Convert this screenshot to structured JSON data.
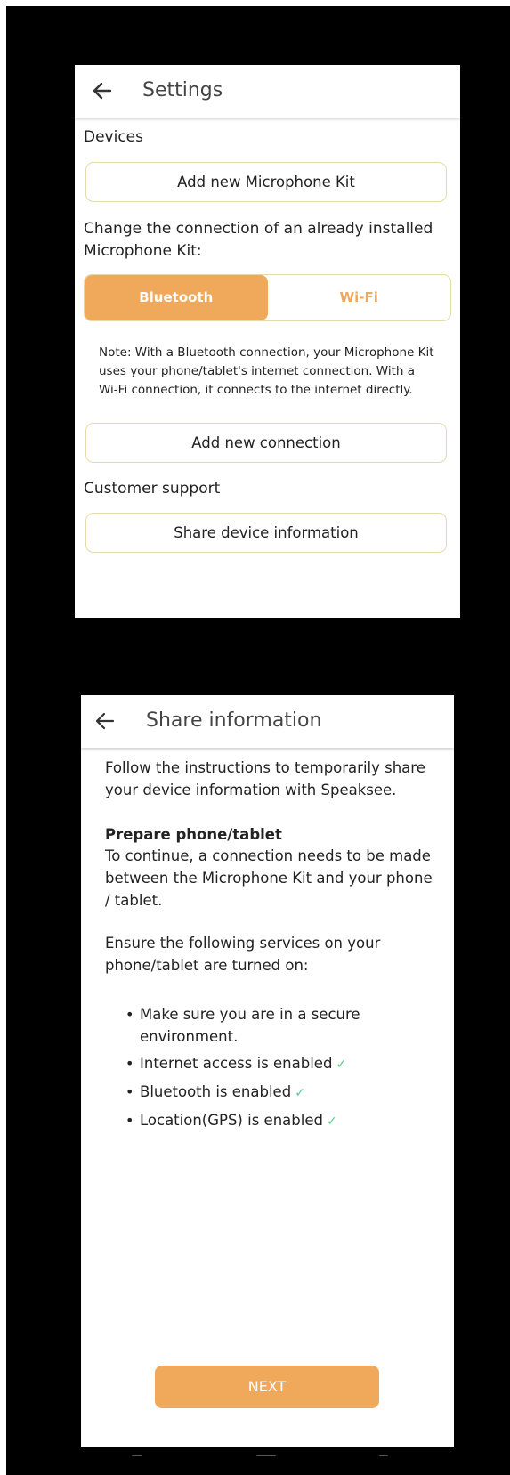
{
  "settings_screen": {
    "title": "Settings",
    "devices_heading": "Devices",
    "add_kit_button": "Add new Microphone Kit",
    "change_connection_text": "Change the connection of an already installed Microphone Kit:",
    "connection_options": [
      "Bluetooth",
      "Wi-Fi"
    ],
    "selected_connection": "Bluetooth",
    "note": "Note: With a Bluetooth connection, your Microphone Kit uses your phone/tablet's internet connection. With a Wi-Fi connection, it connects to the internet directly.",
    "add_connection_button": "Add new connection",
    "support_heading": "Customer support",
    "share_info_button": "Share device information"
  },
  "share_screen": {
    "title": "Share information",
    "intro": "Follow the instructions to temporarily share your device information with Speaksee.",
    "prepare_heading": "Prepare phone/tablet",
    "prepare_text": "To continue, a connection needs to be made between the Microphone Kit and your phone / tablet.",
    "services_text": "Ensure the following services on your phone/tablet are turned on:",
    "checklist": [
      {
        "text": "Make sure you are in a secure environment.",
        "check": ""
      },
      {
        "text": "Internet access is enabled",
        "check": "✓"
      },
      {
        "text": "Bluetooth is enabled",
        "check": "✓"
      },
      {
        "text": "Location(GPS) is enabled",
        "check": "✓"
      }
    ],
    "next_button": "NEXT"
  },
  "colors": {
    "accent": "#f0a95a",
    "border": "#e4dba8",
    "check": "#5cc98a",
    "frame": "#000000"
  },
  "icons": {
    "back": "arrow-left-icon",
    "check": "checkmark-icon"
  }
}
